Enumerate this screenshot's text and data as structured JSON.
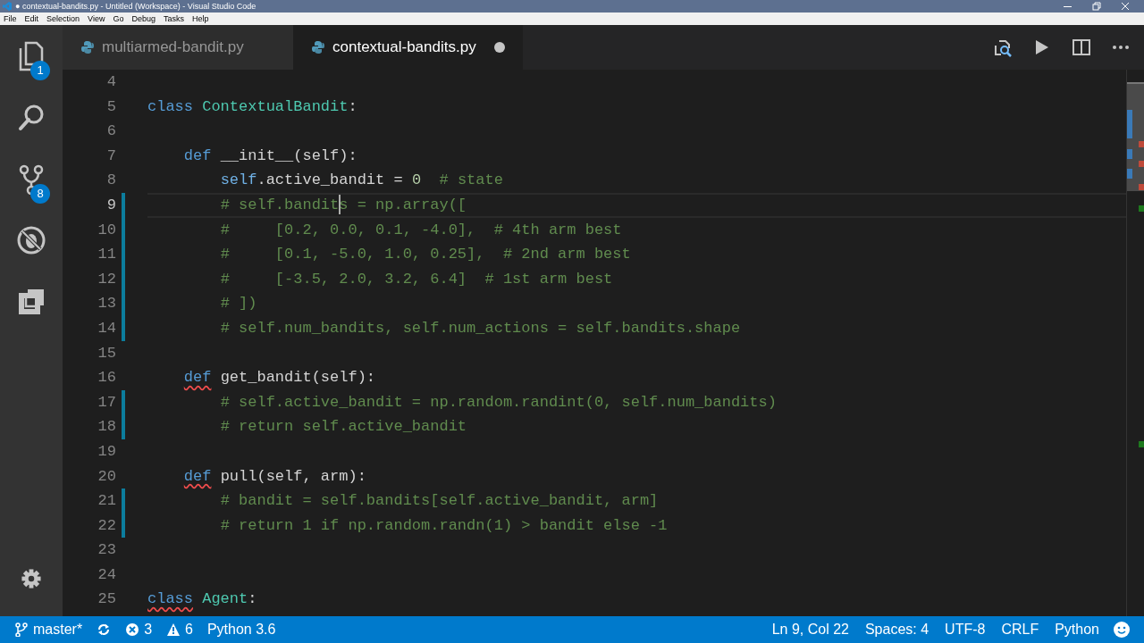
{
  "window": {
    "title": "● contextual-bandits.py - Untitled (Workspace) - Visual Studio Code"
  },
  "menu": [
    "File",
    "Edit",
    "Selection",
    "View",
    "Go",
    "Debug",
    "Tasks",
    "Help"
  ],
  "activity_bar": {
    "top": [
      {
        "kind": "explorer",
        "badge": "1"
      },
      {
        "kind": "search"
      },
      {
        "kind": "source-control",
        "badge": "8"
      },
      {
        "kind": "debug"
      },
      {
        "kind": "extensions"
      }
    ],
    "bottom": [
      {
        "kind": "settings"
      }
    ]
  },
  "tabs": [
    {
      "label": "multiarmed-bandit.py",
      "selected": false,
      "dirty": false
    },
    {
      "label": "contextual-bandits.py",
      "selected": true,
      "dirty": true
    }
  ],
  "editor_actions": [
    {
      "kind": "open-preview"
    },
    {
      "kind": "run"
    },
    {
      "kind": "split"
    },
    {
      "kind": "more"
    }
  ],
  "editor": {
    "lines": [
      {
        "number": "4",
        "modified": false,
        "current": false
      },
      {
        "number": "5",
        "modified": false,
        "current": false,
        "tokens": [
          {
            "kind": "keyword",
            "text": "class"
          },
          {
            "kind": "class",
            "text": " ContextualBandit"
          },
          {
            "kind": "plain",
            "text": ":"
          }
        ]
      },
      {
        "number": "6",
        "modified": false,
        "current": false
      },
      {
        "number": "7",
        "modified": false,
        "current": false,
        "tokens": [
          {
            "kind": "keyword",
            "text": "    def"
          },
          {
            "kind": "plain",
            "text": " __init__(self):"
          }
        ]
      },
      {
        "number": "8",
        "modified": false,
        "current": false,
        "tokens": [
          {
            "kind": "self",
            "text": "        self"
          },
          {
            "kind": "plain",
            "text": ".active_bandit = "
          },
          {
            "kind": "number",
            "text": "0"
          },
          {
            "kind": "comment",
            "text": "  # state"
          }
        ]
      },
      {
        "number": "9",
        "modified": true,
        "current": true,
        "tokens": [
          {
            "kind": "comment",
            "text": "        # self.bandit"
          },
          {
            "kind": "cursor"
          },
          {
            "kind": "comment",
            "text": "s = np.array(["
          }
        ]
      },
      {
        "number": "10",
        "modified": true,
        "current": false,
        "tokens": [
          {
            "kind": "comment",
            "text": "        #     [0.2, 0.0, 0.1, -4.0],  # 4th arm best"
          }
        ]
      },
      {
        "number": "11",
        "modified": true,
        "current": false,
        "tokens": [
          {
            "kind": "comment",
            "text": "        #     [0.1, -5.0, 1.0, 0.25],  # 2nd arm best"
          }
        ]
      },
      {
        "number": "12",
        "modified": true,
        "current": false,
        "tokens": [
          {
            "kind": "comment",
            "text": "        #     [-3.5, 2.0, 3.2, 6.4]  # 1st arm best"
          }
        ]
      },
      {
        "number": "13",
        "modified": true,
        "current": false,
        "tokens": [
          {
            "kind": "comment",
            "text": "        # ])"
          }
        ]
      },
      {
        "number": "14",
        "modified": true,
        "current": false,
        "tokens": [
          {
            "kind": "comment",
            "text": "        # self.num_bandits, self.num_actions = self.bandits.shape"
          }
        ]
      },
      {
        "number": "15",
        "modified": false,
        "current": false
      },
      {
        "number": "16",
        "modified": false,
        "current": false,
        "tokens": [
          {
            "kind": "keyword",
            "text": "    def",
            "error": true
          },
          {
            "kind": "plain",
            "text": " get_bandit(self):"
          }
        ]
      },
      {
        "number": "17",
        "modified": true,
        "current": false,
        "tokens": [
          {
            "kind": "comment",
            "text": "        # self.active_bandit = np.random.randint(0, self.num_bandits)"
          }
        ]
      },
      {
        "number": "18",
        "modified": true,
        "current": false,
        "tokens": [
          {
            "kind": "comment",
            "text": "        # return self.active_bandit"
          }
        ]
      },
      {
        "number": "19",
        "modified": false,
        "current": false
      },
      {
        "number": "20",
        "modified": false,
        "current": false,
        "tokens": [
          {
            "kind": "keyword",
            "text": "    def",
            "error": true
          },
          {
            "kind": "plain",
            "text": " pull(self, arm):"
          }
        ]
      },
      {
        "number": "21",
        "modified": true,
        "current": false,
        "tokens": [
          {
            "kind": "comment",
            "text": "        # bandit = self.bandits[self.active_bandit, arm]"
          }
        ]
      },
      {
        "number": "22",
        "modified": true,
        "current": false,
        "tokens": [
          {
            "kind": "comment",
            "text": "        # return 1 if np.random.randn(1) > bandit else -1"
          }
        ]
      },
      {
        "number": "23",
        "modified": false,
        "current": false
      },
      {
        "number": "24",
        "modified": false,
        "current": false
      },
      {
        "number": "25",
        "modified": false,
        "current": false,
        "tokens": [
          {
            "kind": "keyword",
            "text": "class",
            "error": true
          },
          {
            "kind": "class",
            "text": " Agent"
          },
          {
            "kind": "plain",
            "text": ":"
          }
        ]
      }
    ]
  },
  "status_bar": {
    "left": [
      {
        "kind": "branch",
        "text": "master*"
      },
      {
        "kind": "sync"
      },
      {
        "kind": "errors",
        "text": "3"
      },
      {
        "kind": "warnings",
        "text": "6"
      },
      {
        "kind": "text",
        "text": "Python 3.6"
      }
    ],
    "right": [
      {
        "kind": "text",
        "text": "Ln 9, Col 22"
      },
      {
        "kind": "text",
        "text": "Spaces: 4"
      },
      {
        "kind": "text",
        "text": "UTF-8"
      },
      {
        "kind": "text",
        "text": "CRLF"
      },
      {
        "kind": "text",
        "text": "Python"
      },
      {
        "kind": "feedback"
      }
    ]
  }
}
